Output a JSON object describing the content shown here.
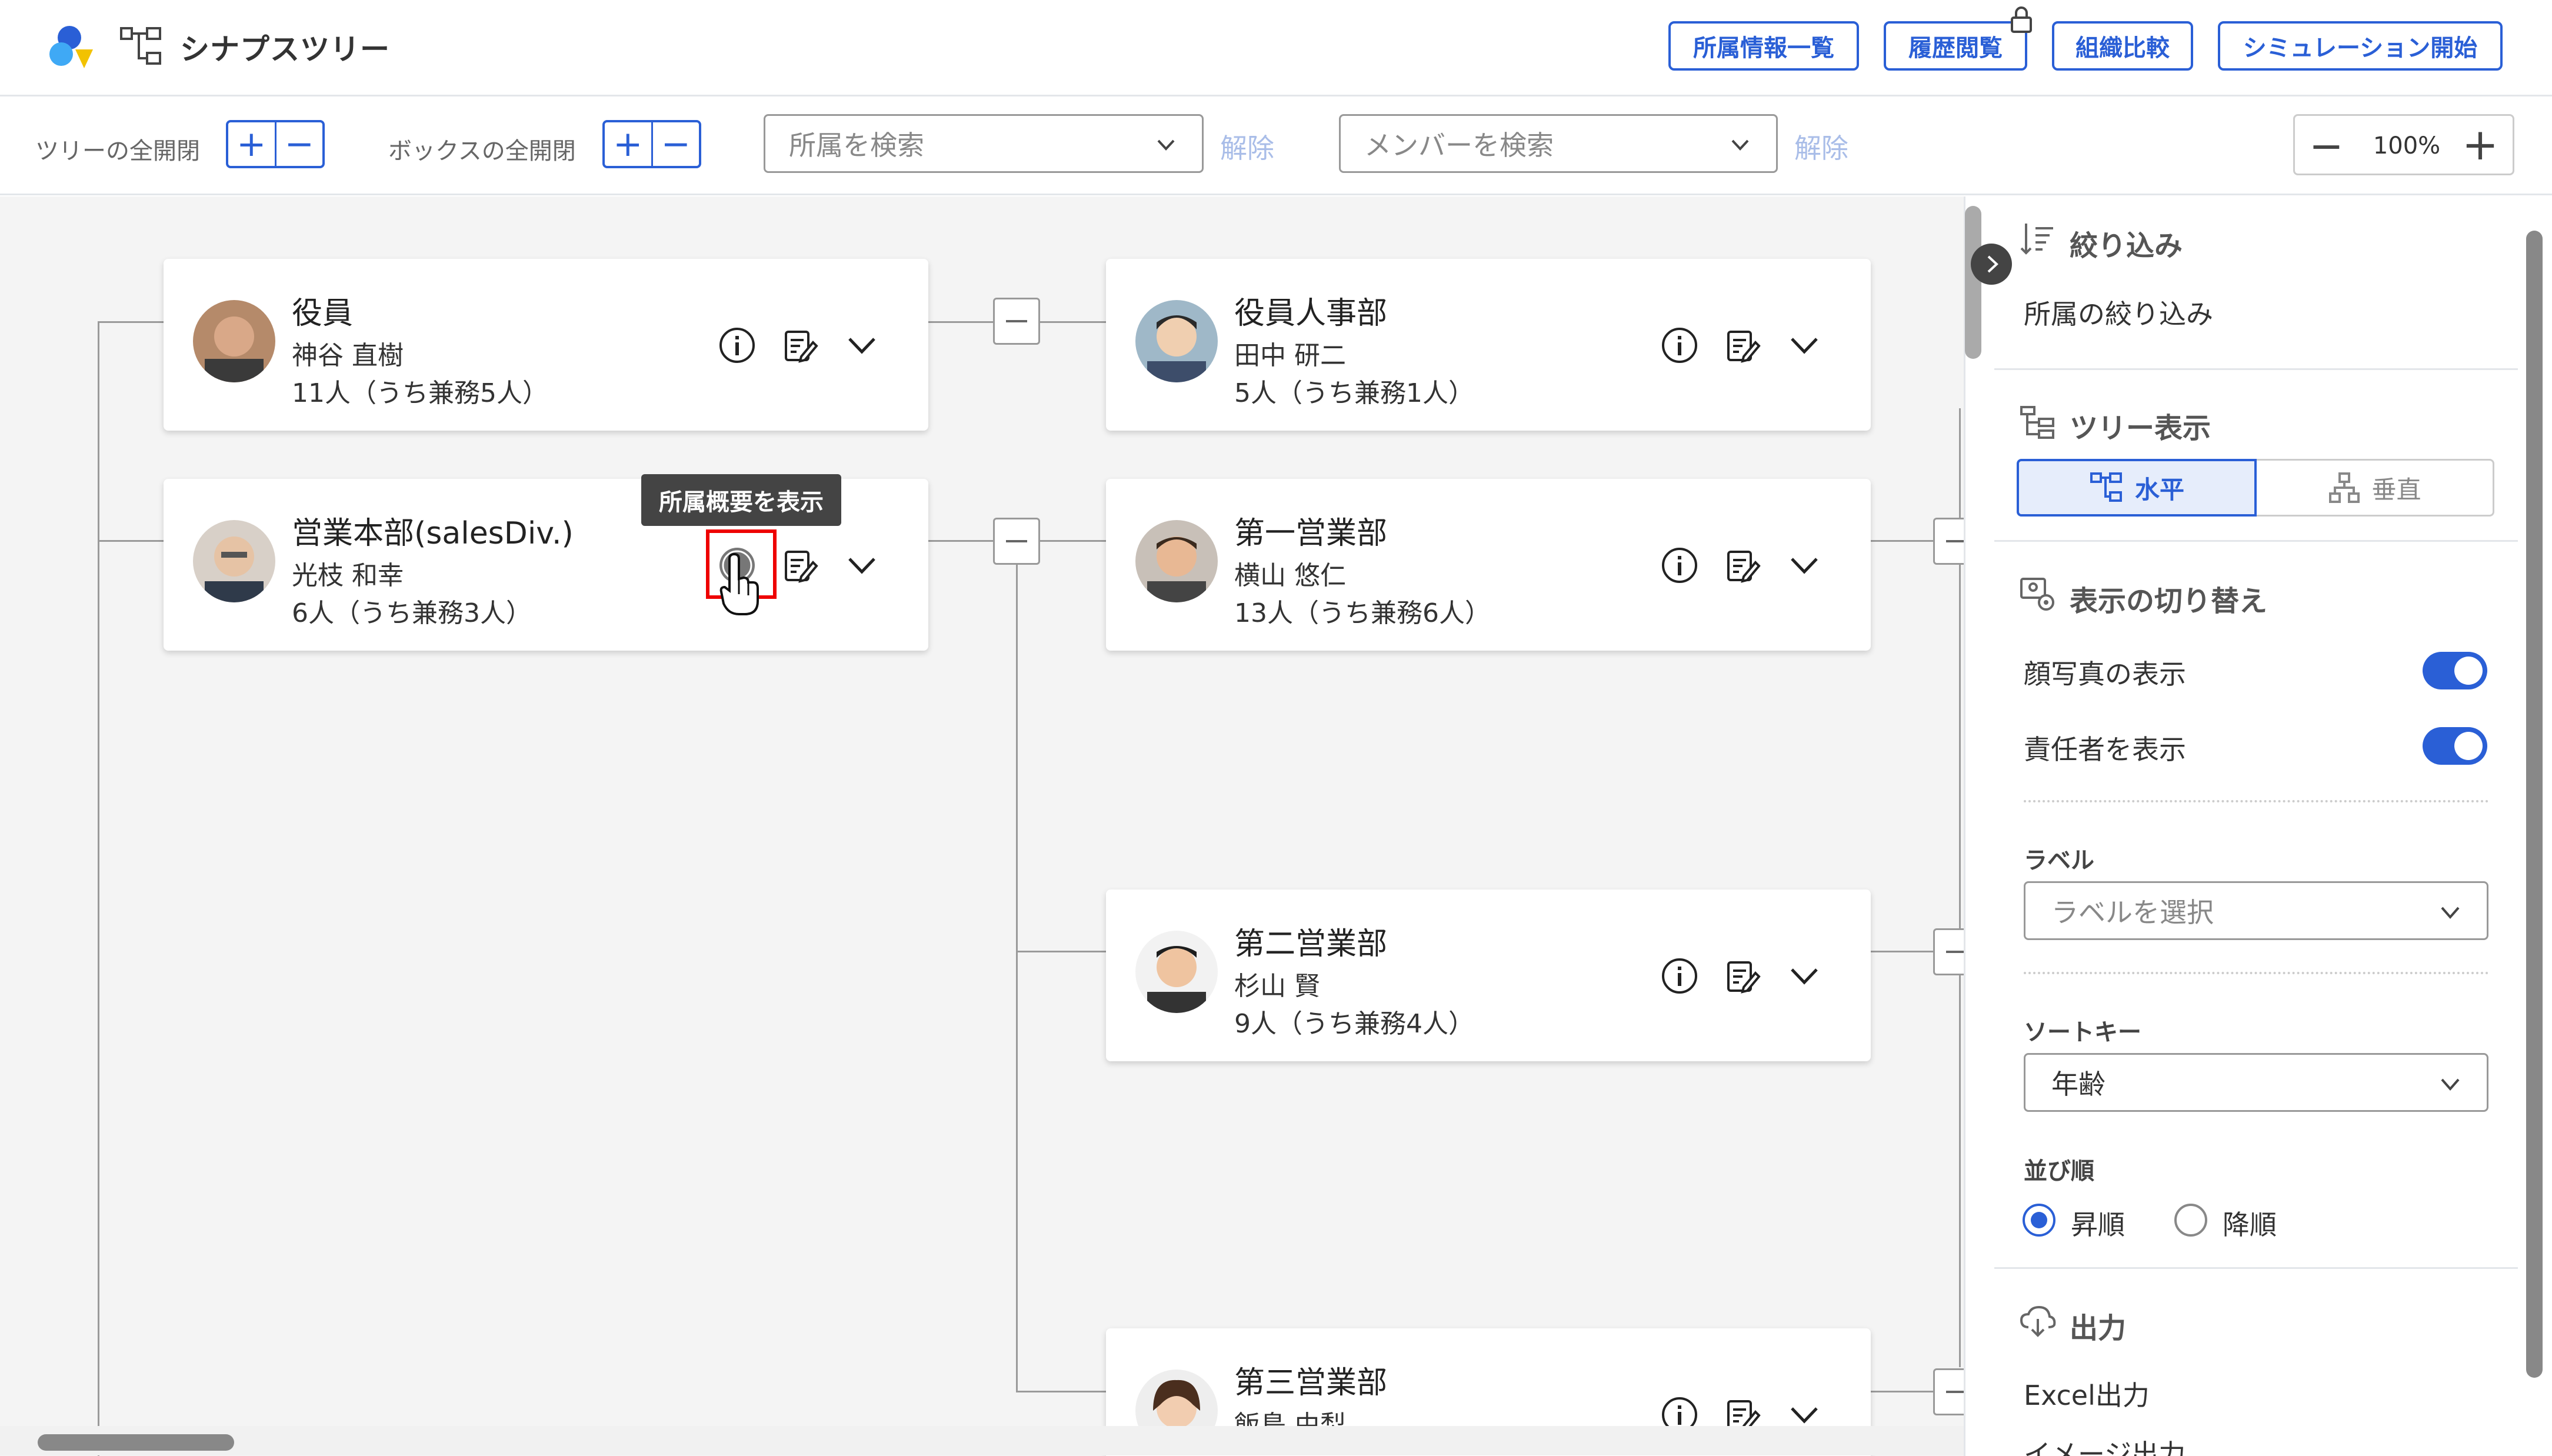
{
  "header": {
    "app_title": "シナプスツリー",
    "buttons": {
      "affiliation_list": "所属情報一覧",
      "history": "履歴閲覧",
      "compare": "組織比較",
      "simulation": "シミュレーション開始"
    }
  },
  "toolbar": {
    "tree_toggle_label": "ツリーの全開閉",
    "box_toggle_label": "ボックスの全開閉",
    "plus": "+",
    "minus": "−",
    "affiliation_search_placeholder": "所属を検索",
    "member_search_placeholder": "メンバーを検索",
    "clear_label": "解除",
    "zoom": "100%",
    "zoom_out": "−",
    "zoom_in": "+"
  },
  "tree": {
    "nodes": [
      {
        "name": "役員",
        "leader": "神谷 直樹",
        "count": "11人（うち兼務5人）"
      },
      {
        "name": "営業本部(salesDiv.)",
        "leader": "光枝 和幸",
        "count": "6人（うち兼務3人）"
      },
      {
        "name": "役員人事部",
        "leader": "田中 研二",
        "count": "5人（うち兼務1人）"
      },
      {
        "name": "第一営業部",
        "leader": "横山 悠仁",
        "count": "13人（うち兼務6人）"
      },
      {
        "name": "第二営業部",
        "leader": "杉山 賢",
        "count": "9人（うち兼務4人）"
      },
      {
        "name": "第三営業部",
        "leader": "飯島 由梨",
        "count": ""
      }
    ],
    "tooltip": "所属概要を表示"
  },
  "panel": {
    "filter_title": "絞り込み",
    "filter_item": "所属の絞り込み",
    "tree_view_title": "ツリー表示",
    "horizontal": "水平",
    "vertical": "垂直",
    "display_title": "表示の切り替え",
    "show_photo": "顔写真の表示",
    "show_leader": "責任者を表示",
    "label_title": "ラベル",
    "label_placeholder": "ラベルを選択",
    "sort_key_title": "ソートキー",
    "sort_key_value": "年齢",
    "order_title": "並び順",
    "ascending": "昇順",
    "descending": "降順",
    "output_title": "出力",
    "excel_output": "Excel出力",
    "image_output": "イメージ出力"
  },
  "colors": {
    "accent": "#2a5fd6",
    "highlight": "#e00000"
  }
}
